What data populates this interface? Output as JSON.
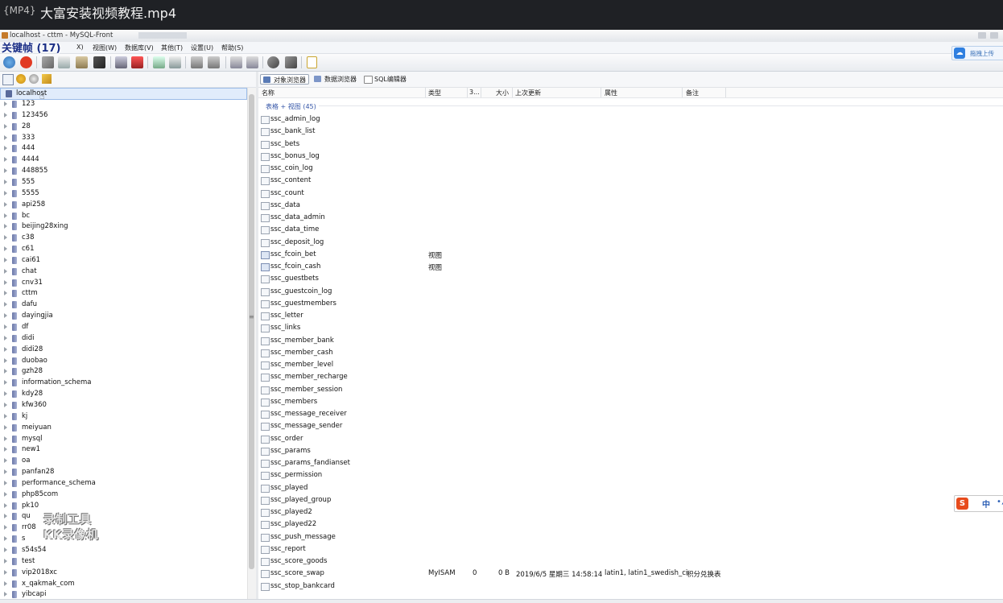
{
  "player": {
    "tag": "{MP4}",
    "title": "大富安装视频教程.mp4"
  },
  "window": {
    "title": "localhost - cttm - MySQL-Front"
  },
  "overlay": {
    "keys": "关键帧 (17)",
    "watermark_line1": "录制工具",
    "watermark_line2": "KK录像机"
  },
  "menu": [
    "X)",
    "视图(W)",
    "数据库(V)",
    "其他(T)",
    "设置(U)",
    "帮助(S)"
  ],
  "toolbar_icons": [
    "refresh-icon",
    "stop-icon",
    "cut-icon",
    "copy-icon",
    "paste-icon",
    "delete-icon",
    "new-db-icon",
    "drop-db-icon",
    "add-table-icon",
    "remove-table-icon",
    "link-icon",
    "unlink-icon",
    "add-index-icon",
    "drop-index-icon",
    "search-icon",
    "replace-icon",
    "checklist-icon"
  ],
  "cloud": {
    "label": "拖拽上传"
  },
  "right_tabs": [
    "对象浏览器",
    "数据浏览器",
    "SQL编辑器"
  ],
  "columns": [
    "名称",
    "类型",
    "3...",
    "大小",
    "上次更新",
    "属性",
    "备注"
  ],
  "group": "表格 + 视图 (45)",
  "tree": {
    "root": "localhost",
    "items": [
      "123",
      "123456",
      "28",
      "333",
      "444",
      "4444",
      "448855",
      "555",
      "5555",
      "api258",
      "bc",
      "beijing28xing",
      "c38",
      "c61",
      "cai61",
      "chat",
      "cnv31",
      "cttm",
      "dafu",
      "dayingjia",
      "df",
      "didi",
      "didi28",
      "duobao",
      "gzh28",
      "information_schema",
      "kdy28",
      "kfw360",
      "kj",
      "meiyuan",
      "mysql",
      "new1",
      "oa",
      "panfan28",
      "performance_schema",
      "php85com",
      "pk10",
      "qu",
      "rr08",
      "s",
      "s54s54",
      "test",
      "vip2018xc",
      "x_qakmak_com",
      "yibcapi"
    ]
  },
  "tables": [
    {
      "name": "ssc_admin_log"
    },
    {
      "name": "ssc_bank_list"
    },
    {
      "name": "ssc_bets"
    },
    {
      "name": "ssc_bonus_log"
    },
    {
      "name": "ssc_coin_log"
    },
    {
      "name": "ssc_content"
    },
    {
      "name": "ssc_count"
    },
    {
      "name": "ssc_data"
    },
    {
      "name": "ssc_data_admin"
    },
    {
      "name": "ssc_data_time"
    },
    {
      "name": "ssc_deposit_log"
    },
    {
      "name": "ssc_fcoin_bet",
      "type": "视图"
    },
    {
      "name": "ssc_fcoin_cash",
      "type": "视图"
    },
    {
      "name": "ssc_guestbets"
    },
    {
      "name": "ssc_guestcoin_log"
    },
    {
      "name": "ssc_guestmembers"
    },
    {
      "name": "ssc_letter"
    },
    {
      "name": "ssc_links"
    },
    {
      "name": "ssc_member_bank"
    },
    {
      "name": "ssc_member_cash"
    },
    {
      "name": "ssc_member_level"
    },
    {
      "name": "ssc_member_recharge"
    },
    {
      "name": "ssc_member_session"
    },
    {
      "name": "ssc_members"
    },
    {
      "name": "ssc_message_receiver"
    },
    {
      "name": "ssc_message_sender"
    },
    {
      "name": "ssc_order"
    },
    {
      "name": "ssc_params"
    },
    {
      "name": "ssc_params_fandianset"
    },
    {
      "name": "ssc_permission"
    },
    {
      "name": "ssc_played"
    },
    {
      "name": "ssc_played_group"
    },
    {
      "name": "ssc_played2"
    },
    {
      "name": "ssc_played22"
    },
    {
      "name": "ssc_push_message"
    },
    {
      "name": "ssc_report"
    },
    {
      "name": "ssc_score_goods"
    },
    {
      "name": "ssc_score_swap",
      "type": "MyISAM",
      "rows": "0",
      "size": "0 B",
      "updated": "2019/6/5 星期三 14:58:14",
      "attrs": "latin1, latin1_swedish_ci",
      "note": "积分兑换表"
    },
    {
      "name": "ssc_stop_bankcard"
    }
  ],
  "ime": {
    "logo": "S",
    "lang": "中",
    "punct": "•,"
  }
}
